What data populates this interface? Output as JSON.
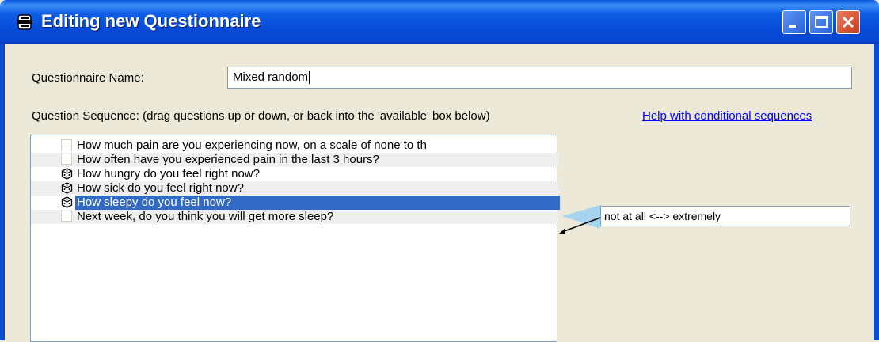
{
  "window": {
    "title": "Editing new Questionnaire",
    "colors": {
      "titlebar": "#0A4BD3",
      "selection": "#316AC5",
      "face": "#ECE9D8",
      "link": "#0000FF"
    }
  },
  "form": {
    "name_label": "Questionnaire Name:",
    "name_value": "Mixed random",
    "sequence_label": "Question Sequence: (drag questions up or down, or back into the 'available' box below)",
    "help_link": "Help with conditional sequences"
  },
  "questions": [
    {
      "text": "How much pain are you experiencing now, on a scale of none to th",
      "icon": "checkbox",
      "selected": false
    },
    {
      "text": "How often have you experienced pain in the last 3 hours?",
      "icon": "checkbox",
      "selected": false
    },
    {
      "text": "How hungry do you feel right now?",
      "icon": "random-cube-icon",
      "selected": false
    },
    {
      "text": "How sick do you feel right now?",
      "icon": "random-cube-icon",
      "selected": false
    },
    {
      "text": "How sleepy do you feel now?",
      "icon": "random-cube-icon",
      "selected": true
    },
    {
      "text": "Next week, do you think you will get more sleep?",
      "icon": "checkbox",
      "selected": false
    }
  ],
  "answer": {
    "text": "not at all <--> extremely"
  }
}
